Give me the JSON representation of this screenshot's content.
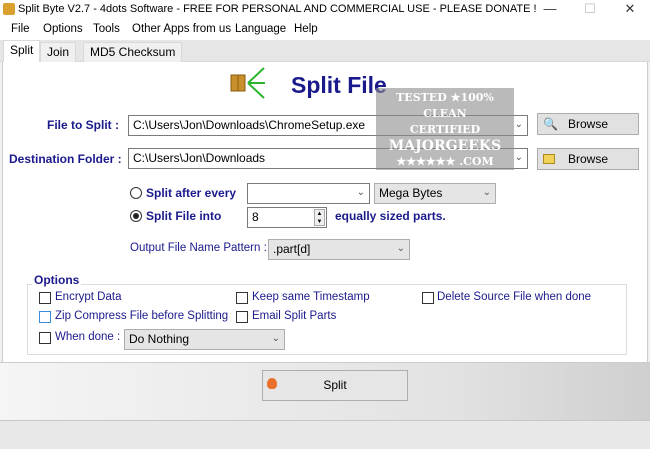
{
  "window": {
    "title": "Split Byte V2.7 - 4dots Software - FREE FOR PERSONAL AND COMMERCIAL USE - PLEASE DONATE !",
    "minimize": "—",
    "maximize": "☐",
    "close": "✕"
  },
  "menu": [
    "File",
    "Options",
    "Tools",
    "Other Apps from us",
    "Language",
    "Help"
  ],
  "tabs": [
    "Split",
    "Join",
    "MD5 Checksum"
  ],
  "heading": "Split File",
  "file_to_split": {
    "label": "File to Split :",
    "value": "C:\\Users\\Jon\\Downloads\\ChromeSetup.exe",
    "browse": "Browse"
  },
  "destination": {
    "label": "Destination Folder :",
    "value": "C:\\Users\\Jon\\Downloads",
    "browse": "Browse"
  },
  "split_after": {
    "label": "Split after every",
    "value": "",
    "unit": "Mega Bytes",
    "selected": false
  },
  "split_into": {
    "label": "Split File into",
    "value": "8",
    "suffix": "equally sized parts.",
    "selected": true
  },
  "pattern": {
    "label": "Output File Name Pattern :",
    "value": ".part[d]"
  },
  "options": {
    "title": "Options",
    "encrypt": "Encrypt Data",
    "keep_timestamp": "Keep same Timestamp",
    "delete_source": "Delete Source File when done",
    "zip": "Zip Compress File before Splitting",
    "email": "Email Split Parts",
    "when_done": "When done :",
    "when_done_value": "Do Nothing"
  },
  "split_button": "Split",
  "watermark": {
    "line1": "TESTED ★100% CLEAN",
    "line2": "CERTIFIED",
    "line3": "MAJORGEEKS",
    "line4": "★★★★★★ .COM"
  }
}
